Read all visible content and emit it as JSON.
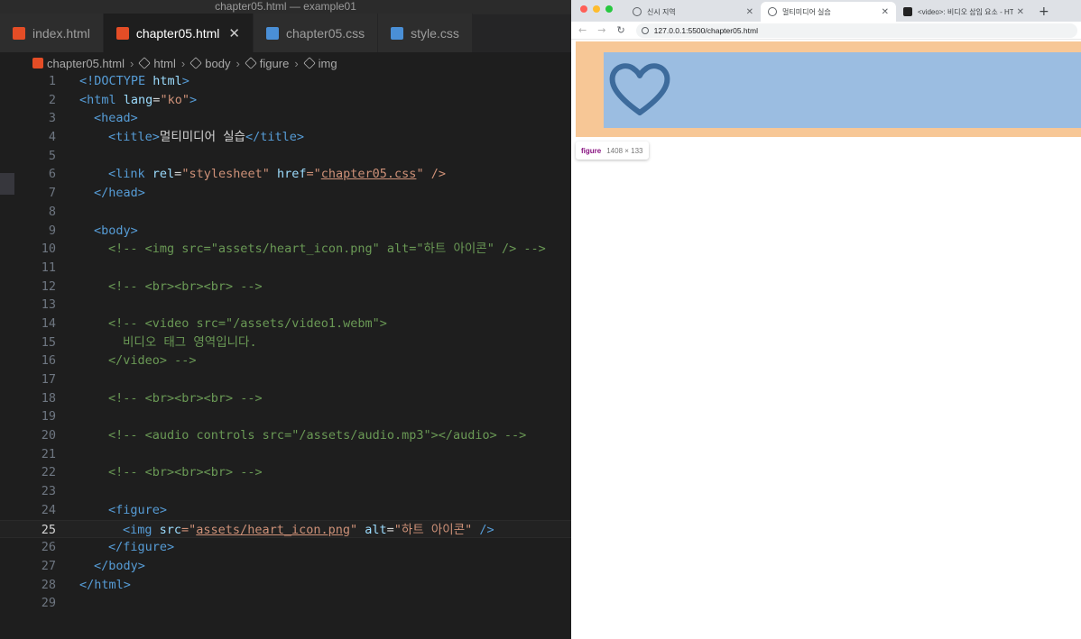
{
  "window": {
    "title": "chapter05.html — example01"
  },
  "editor": {
    "tabs": [
      {
        "label": "index.html",
        "type": "html"
      },
      {
        "label": "chapter05.html",
        "type": "html",
        "active": true
      },
      {
        "label": "chapter05.css",
        "type": "css"
      },
      {
        "label": "style.css",
        "type": "css"
      }
    ],
    "breadcrumb": [
      "chapter05.html",
      "html",
      "body",
      "figure",
      "img"
    ],
    "current_line": 25,
    "line_numbers": [
      "1",
      "2",
      "3",
      "4",
      "5",
      "6",
      "7",
      "8",
      "9",
      "10",
      "11",
      "12",
      "13",
      "14",
      "15",
      "16",
      "17",
      "18",
      "19",
      "20",
      "21",
      "22",
      "23",
      "24",
      "25",
      "26",
      "27",
      "28",
      "29"
    ],
    "code": {
      "l1": {
        "a": "<!DOCTYPE ",
        "b": "html",
        "c": ">"
      },
      "l2": {
        "a": "<html ",
        "b": "lang",
        "c": "=",
        "d": "\"ko\"",
        "e": ">"
      },
      "l3": {
        "a": "<head>"
      },
      "l4": {
        "a": "<title>",
        "b": "멀티미디어 실습",
        "c": "</title>"
      },
      "l6": {
        "a": "<link ",
        "b": "rel",
        "c": "=",
        "d": "\"stylesheet\"",
        "e": " href",
        "f": "=\"",
        "g": "chapter05.css",
        "h": "\" />"
      },
      "l7": {
        "a": "</head>"
      },
      "l9": {
        "a": "<body>"
      },
      "l10": {
        "a": "<!-- <img src=\"assets/heart_icon.png\" alt=\"하트 아이콘\" /> -->"
      },
      "l12": {
        "a": "<!-- <br><br><br> -->"
      },
      "l14": {
        "a": "<!-- <video src=\"/assets/video1.webm\">"
      },
      "l15": {
        "a": "비디오 태그 영역입니다."
      },
      "l16": {
        "a": "</video> -->"
      },
      "l18": {
        "a": "<!-- <br><br><br> -->"
      },
      "l20": {
        "a": "<!-- <audio controls src=\"/assets/audio.mp3\"></audio> -->"
      },
      "l22": {
        "a": "<!-- <br><br><br> -->"
      },
      "l24": {
        "a": "<figure>"
      },
      "l25": {
        "a": "<img ",
        "b": "src",
        "c": "=\"",
        "d": "assets/heart_icon.png",
        "e": "\" ",
        "f": "alt",
        "g": "=",
        "h": "\"하트 아이콘\"",
        "i": " />"
      },
      "l26": {
        "a": "</figure>"
      },
      "l27": {
        "a": "</body>"
      },
      "l28": {
        "a": "</html>"
      }
    }
  },
  "browser": {
    "tabs": [
      {
        "label": "신시 지역"
      },
      {
        "label": "멀티미디어 실습",
        "active": true
      },
      {
        "label": "<video>: 비디오 삽입 요소 - HTML"
      }
    ],
    "new_tab": "+",
    "url": "127.0.0.1:5500/chapter05.html",
    "tooltip": {
      "tag": "figure",
      "dims": "1408 × 133"
    }
  },
  "colors": {
    "figure_margin": "#f7c796",
    "figure_content": "#9bbde1",
    "heart_stroke": "#3d6b9c"
  }
}
